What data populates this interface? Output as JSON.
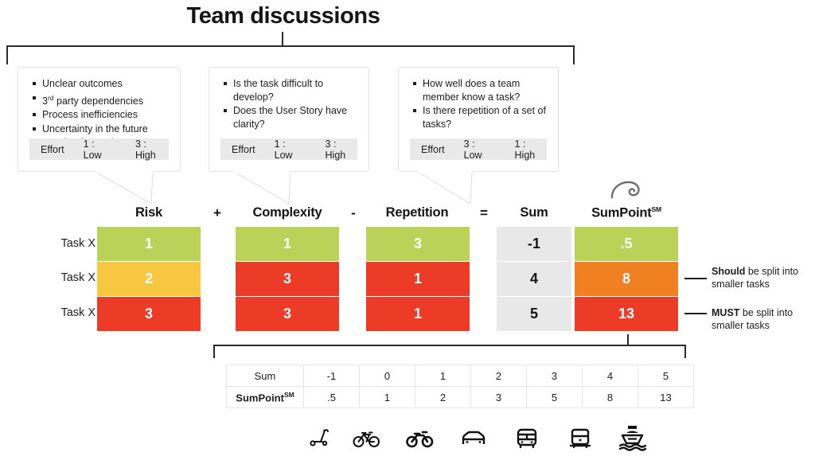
{
  "title": "Team discussions",
  "bubbles": [
    {
      "id": "risk-bubble",
      "items": [
        {
          "text": "Unclear outcomes",
          "sup": ""
        },
        {
          "text": "party dependencies",
          "sup": "rd",
          "prefix": "3"
        },
        {
          "text": "Process inefficiencies",
          "sup": ""
        },
        {
          "text": "Uncertainty in the future",
          "sup": ""
        },
        {
          "text": "Leaning forward",
          "sup": ""
        }
      ],
      "effort": {
        "label": "Effort",
        "low": "1 : Low",
        "high": "3 : High"
      }
    },
    {
      "id": "complexity-bubble",
      "items": [
        {
          "text": "Is the task difficult to develop?",
          "sup": ""
        },
        {
          "text": "Does the User Story have clarity?",
          "sup": ""
        }
      ],
      "effort": {
        "label": "Effort",
        "low": "1 : Low",
        "high": "3 : High"
      }
    },
    {
      "id": "repetition-bubble",
      "items": [
        {
          "text": "How well does a team member know a task?",
          "sup": ""
        },
        {
          "text": "Is there repetition of a set of tasks?",
          "sup": ""
        }
      ],
      "effort": {
        "label": "Effort",
        "low": "3 : Low",
        "high": "1 : High"
      }
    }
  ],
  "matrix": {
    "headers": {
      "risk": "Risk",
      "complexity": "Complexity",
      "repetition": "Repetition",
      "sum": "Sum",
      "sumpoint": "SumPoint",
      "sumpoint_sup": "SM"
    },
    "operators": {
      "plus": "+",
      "minus": "-",
      "equals": "="
    },
    "row_labels": [
      "Task X",
      "Task X",
      "Task X"
    ],
    "rows": [
      {
        "risk": {
          "value": "1",
          "color": "#bcd157"
        },
        "complexity": {
          "value": "1",
          "color": "#bcd157"
        },
        "repetition": {
          "value": "3",
          "color": "#bcd157"
        },
        "sum": {
          "value": "-1",
          "color": "#e8e8e8"
        },
        "sumpoint": {
          "value": ".5",
          "color": "#bcd157"
        }
      },
      {
        "risk": {
          "value": "2",
          "color": "#f8c741"
        },
        "complexity": {
          "value": "3",
          "color": "#ec3b26"
        },
        "repetition": {
          "value": "1",
          "color": "#ec3b26"
        },
        "sum": {
          "value": "4",
          "color": "#e8e8e8"
        },
        "sumpoint": {
          "value": "8",
          "color": "#f08022"
        }
      },
      {
        "risk": {
          "value": "3",
          "color": "#ec3b26"
        },
        "complexity": {
          "value": "3",
          "color": "#ec3b26"
        },
        "repetition": {
          "value": "1",
          "color": "#ec3b26"
        },
        "sum": {
          "value": "5",
          "color": "#e8e8e8"
        },
        "sumpoint": {
          "value": "13",
          "color": "#ec3b26"
        }
      }
    ]
  },
  "annotations": [
    {
      "strong": "Should",
      "rest": " be split into smaller tasks"
    },
    {
      "strong": "MUST",
      "rest": " be split into smaller tasks"
    }
  ],
  "lookup": {
    "row1_label": "Sum",
    "row2_label": "SumPoint",
    "row2_label_sup": "SM",
    "sum_values": [
      "-1",
      "0",
      "1",
      "2",
      "3",
      "4",
      "5"
    ],
    "sumpoint_values": [
      ".5",
      "1",
      "2",
      "3",
      "5",
      "8",
      "13"
    ]
  },
  "transport_icons": [
    "scooter-icon",
    "bicycle-icon",
    "motorcycle-icon",
    "car-icon",
    "bus-icon",
    "train-icon",
    "ship-icon"
  ],
  "colors": {
    "green": "#bcd157",
    "yellow": "#f8c741",
    "orange": "#f08022",
    "red": "#ec3b26",
    "gray": "#e8e8e8",
    "ink": "#231f20"
  }
}
